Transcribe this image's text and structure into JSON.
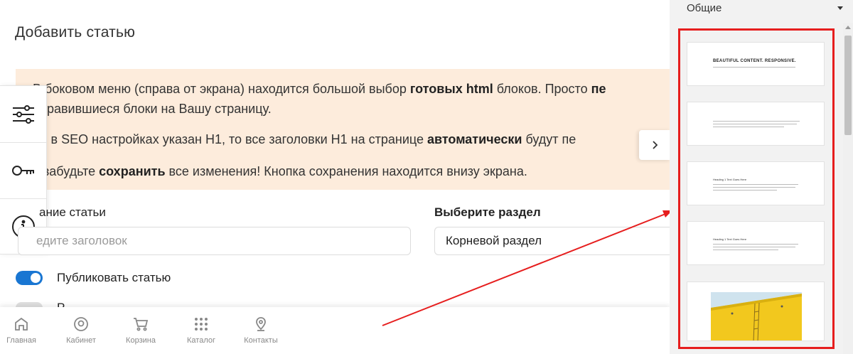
{
  "page": {
    "title": "Добавить статью"
  },
  "info": {
    "line1_pre": "В боковом меню (справа от экрана) находится большой выбор ",
    "line1_bold": "готовых html",
    "line1_mid": " блоков. Просто ",
    "line1_bold2": "пе",
    "line2": "онравившиеся блоки на Вашу страницу.",
    "line3_pre": "ли в SEO настройках указан H1, то все заголовки H1 на странице ",
    "line3_bold": "автоматически",
    "line3_post": " будут пе",
    "line4_pre": "е забудьте ",
    "line4_bold": "сохранить",
    "line4_post": " все изменения! Кнопка сохранения находится внизу экрана."
  },
  "side_tools": [
    {
      "icon": "sliders-icon"
    },
    {
      "icon": "key-icon"
    },
    {
      "icon": "info-icon"
    }
  ],
  "form": {
    "title_label": "ание статьи",
    "title_placeholder": "едите заголовок",
    "section_label": "Выберите раздел",
    "section_value": "Корневой раздел",
    "publish_label": "Публиковать статью",
    "partial_label": "Р"
  },
  "bottom_nav": [
    {
      "label": "Главная",
      "icon": "home-icon"
    },
    {
      "label": "Кабинет",
      "icon": "user-circle-icon"
    },
    {
      "label": "Корзина",
      "icon": "cart-icon"
    },
    {
      "label": "Каталог",
      "icon": "grid-icon"
    },
    {
      "label": "Контакты",
      "icon": "location-pin-icon"
    }
  ],
  "blocks_panel": {
    "category": "Общие",
    "thumb1_title": "BEAUTIFUL CONTENT. RESPONSIVE.",
    "thumb3_heading": "Heading 1 Text Goes Here",
    "thumb4_heading": "Heading 1 Text Goes Here"
  },
  "colors": {
    "info_bg": "#fdecdc",
    "toggle_on": "#1976d2",
    "highlight": "#e61e1e",
    "photo_yellow": "#f2c81e"
  }
}
